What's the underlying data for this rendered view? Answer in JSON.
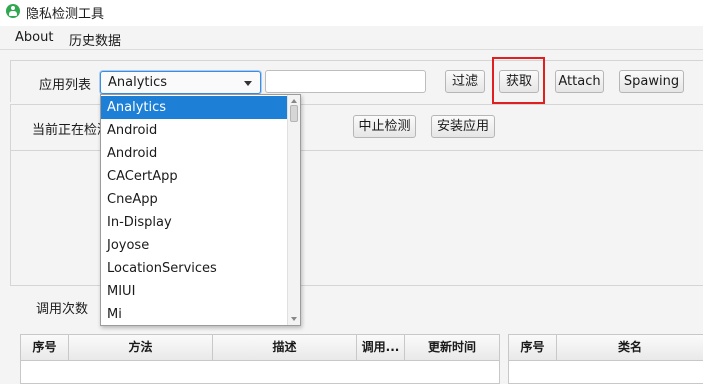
{
  "window": {
    "title": "隐私检测工具"
  },
  "menu": {
    "items": [
      "About",
      "历史数据"
    ]
  },
  "toolbar": {
    "app_list_label": "应用列表",
    "selected_app": "Analytics",
    "filter_value": "",
    "filter_button": "过滤",
    "fetch_button": "获取",
    "attach_button": "Attach",
    "spawning_button": "Spawing",
    "highlight_color": "#e02020"
  },
  "status": {
    "current_label": "当前正在检测",
    "stop_button": "中止检测",
    "install_button": "安装应用"
  },
  "calls": {
    "label": "调用次数"
  },
  "dropdown": {
    "items": [
      "Analytics",
      "Android",
      "Android",
      "CACertApp",
      "CneApp",
      "In-Display",
      "Joyose",
      "LocationServices",
      "MIUI",
      "Mi"
    ],
    "selected_index": 0,
    "accent_color": "#1e7fd6"
  },
  "left_table": {
    "columns": [
      "序号",
      "方法",
      "描述",
      "调用...",
      "更新时间"
    ]
  },
  "right_table": {
    "columns": [
      "序号",
      "类名"
    ]
  }
}
